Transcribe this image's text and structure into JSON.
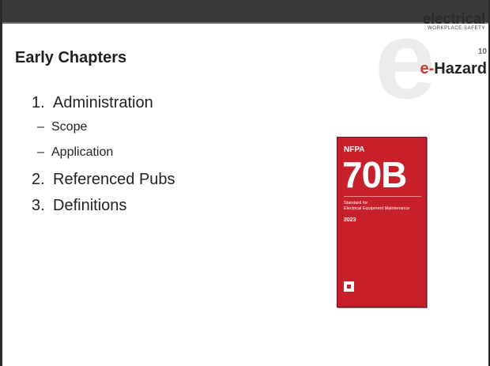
{
  "slide": {
    "title": "Early Chapters",
    "number": "10"
  },
  "brand": {
    "word": "electrical",
    "sub": "WORKPLACE SAFETY",
    "watermark_letter": "e",
    "logo_e": "e",
    "logo_dash": "-",
    "logo_word": "Hazard"
  },
  "outline": [
    {
      "num": "1.",
      "text": "Administration",
      "sub": [
        "Scope",
        "Application"
      ]
    },
    {
      "num": "2.",
      "text": "Referenced Pubs",
      "sub": []
    },
    {
      "num": "3.",
      "text": "Definitions",
      "sub": []
    }
  ],
  "sub_marker": "–",
  "book_cover": {
    "publisher": "NFPA",
    "code": "70B",
    "standard_line1": "Standard for",
    "standard_line2": "Electrical Equipment Maintenance",
    "year": "2023",
    "background_color": "#c8202b"
  },
  "colors": {
    "top_bar": "#3a3a3a",
    "accent_red": "#d23a2a"
  }
}
